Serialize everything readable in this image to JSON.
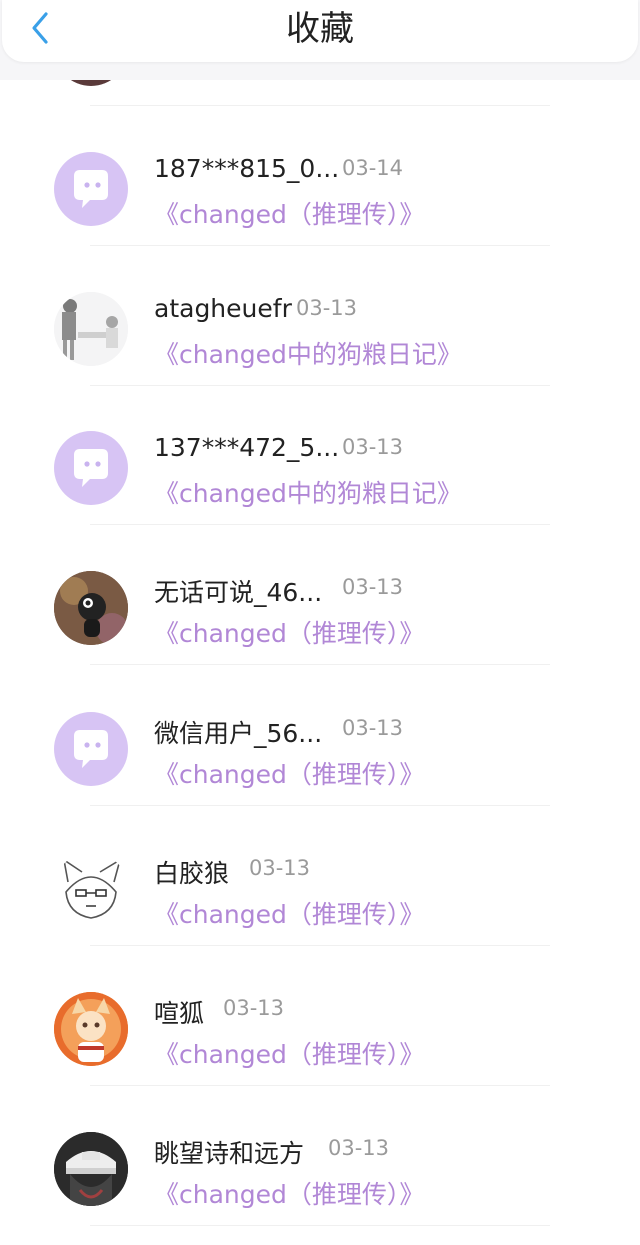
{
  "header": {
    "title": "收藏",
    "back_icon": "chevron-left-icon"
  },
  "colors": {
    "accent": "#b187d6",
    "back_icon": "#3aa0e8",
    "default_avatar_bg": "#d7c4f4"
  },
  "items": [
    {
      "username": "187***815_0...",
      "date": "03-14",
      "book": "《changed（推理传）》",
      "avatar": "default-chat-avatar"
    },
    {
      "username": "atagheuefr",
      "date": "03-13",
      "book": "《changed中的狗粮日记》",
      "avatar": "illustration-avatar"
    },
    {
      "username": "137***472_5...",
      "date": "03-13",
      "book": "《changed中的狗粮日记》",
      "avatar": "default-chat-avatar"
    },
    {
      "username": "无话可说_46...",
      "date": "03-13",
      "book": "《changed（推理传）》",
      "avatar": "illustration-avatar"
    },
    {
      "username": "微信用户_56...",
      "date": "03-13",
      "book": "《changed（推理传）》",
      "avatar": "default-chat-avatar"
    },
    {
      "username": "白胶狼",
      "date": "03-13",
      "book": "《changed（推理传）》",
      "avatar": "sketch-avatar"
    },
    {
      "username": "喧狐",
      "date": "03-13",
      "book": "《changed（推理传）》",
      "avatar": "illustration-avatar"
    },
    {
      "username": "眺望诗和远方",
      "date": "03-13",
      "book": "《changed（推理传）》",
      "avatar": "photo-avatar"
    }
  ]
}
